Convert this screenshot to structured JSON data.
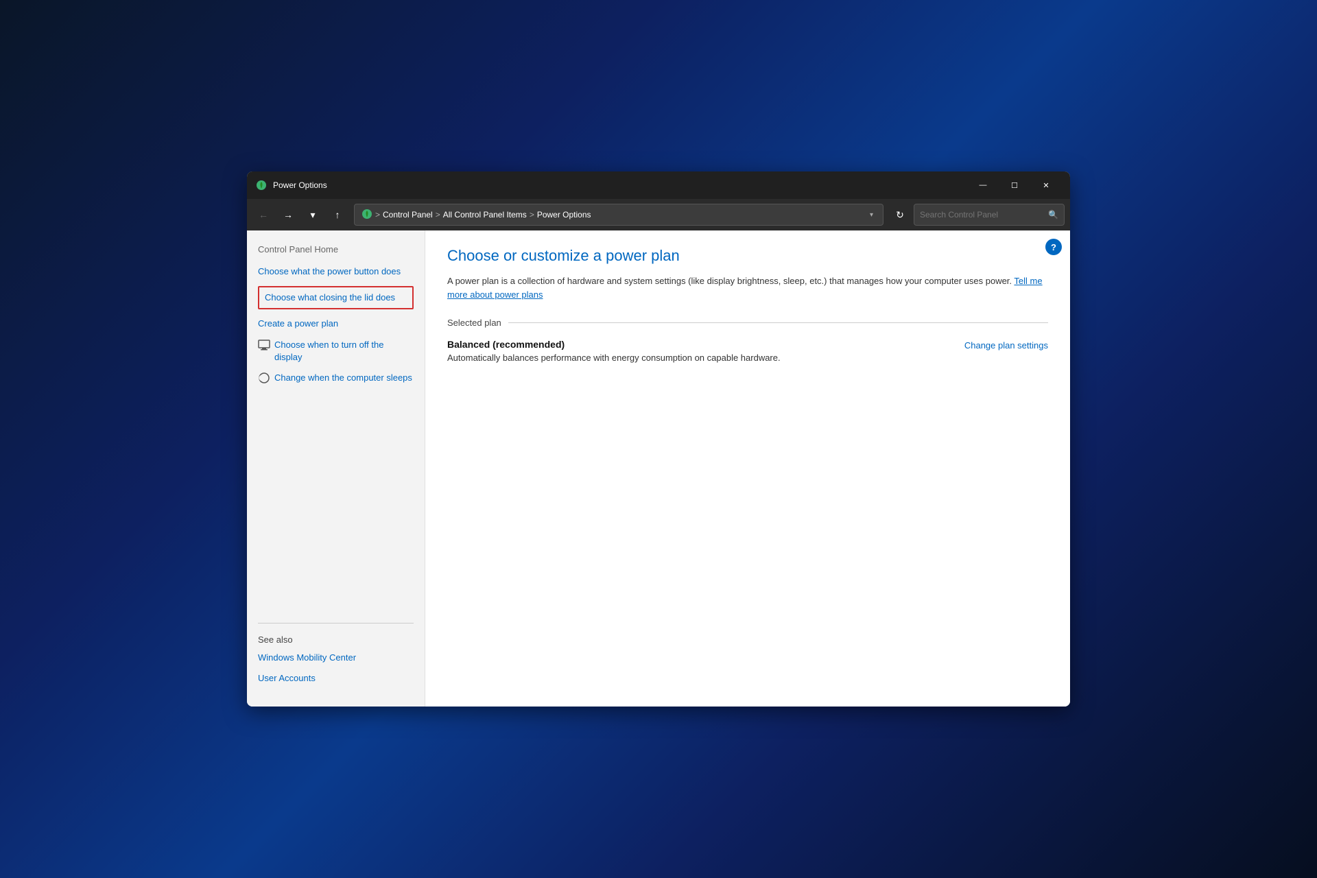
{
  "window": {
    "title": "Power Options",
    "icon": "⚡",
    "controls": {
      "minimize": "—",
      "maximize": "☐",
      "close": "✕"
    }
  },
  "address_bar": {
    "back_btn": "←",
    "forward_btn": "→",
    "dropdown_btn": "▾",
    "up_btn": "↑",
    "path_icon": "🟢",
    "path_separator": ">",
    "path_parts": [
      "Control Panel",
      "All Control Panel Items",
      "Power Options"
    ],
    "refresh_btn": "↻",
    "search_placeholder": "Search Control Panel",
    "search_icon": "🔍"
  },
  "sidebar": {
    "home_label": "Control Panel Home",
    "links": [
      {
        "id": "choose-power-button",
        "text": "Choose what the power button does",
        "highlighted": false
      },
      {
        "id": "choose-lid",
        "text": "Choose what closing the lid does",
        "highlighted": true
      },
      {
        "id": "create-power-plan",
        "text": "Create a power plan",
        "highlighted": false
      }
    ],
    "icon_links": [
      {
        "id": "turn-off-display",
        "text": "Choose when to turn off the display"
      },
      {
        "id": "computer-sleeps",
        "text": "Change when the computer sleeps"
      }
    ],
    "see_also": {
      "label": "See also",
      "items": [
        "Windows Mobility Center",
        "User Accounts"
      ]
    }
  },
  "main": {
    "title": "Choose or customize a power plan",
    "description": "A power plan is a collection of hardware and system settings (like display brightness, sleep, etc.) that manages how your computer uses power.",
    "learn_more_link": "Tell me more about power plans",
    "selected_plan_label": "Selected plan",
    "plan": {
      "name": "Balanced (recommended)",
      "description": "Automatically balances performance with energy consumption on capable hardware.",
      "change_link": "Change plan settings"
    },
    "help_btn": "?"
  }
}
